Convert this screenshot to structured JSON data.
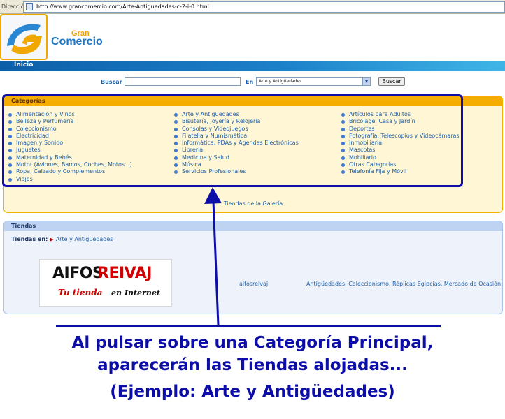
{
  "browser": {
    "address_label": "Dirección",
    "url": "http://www.grancomercio.com/Arte-Antiguedades-c-2-i-0.html"
  },
  "site": {
    "brand_top": "Gran",
    "brand_bottom": "Comercio",
    "accent_color": "#f5ad00",
    "brand_color": "#1f77c7"
  },
  "nav": {
    "items": [
      {
        "label": "Inicio"
      }
    ]
  },
  "search": {
    "label": "Buscar",
    "query": "",
    "in_label": "En",
    "selected_category": "Arte y Antigüedades",
    "button": "Buscar"
  },
  "categories": {
    "title": "Categorías",
    "columns": [
      [
        "Alimentación y Vinos",
        "Belleza y Perfumería",
        "Coleccionismo",
        "Electricidad",
        "Imagen y Sonido",
        "Juguetes",
        "Maternidad y Bebés",
        "Motor (Aviones, Barcos, Coches, Motos...)",
        "Ropa, Calzado y Complementos",
        "Viajes"
      ],
      [
        "Arte y Antigüedades",
        "Bisutería, Joyería y Relojería",
        "Consolas y Videojuegos",
        "Filatelia y Numismática",
        "Informática, PDAs y Agendas Electrónicas",
        "Librería",
        "Medicina y Salud",
        "Música",
        "Servicios Profesionales"
      ],
      [
        "Artículos para Adultos",
        "Bricolage, Casa y Jardín",
        "Deportes",
        "Fotografía, Telescopios y Videocámaras",
        "Inmobiliaria",
        "Mascotas",
        "Mobiliario",
        "Otras Categorías",
        "Telefonía Fija y Móvil"
      ]
    ],
    "gallery_link": "Tiendas de la Galería"
  },
  "stores": {
    "title": "Tiendas",
    "filter_label": "Tiendas en:",
    "filter_value": "Arte y Antigüedades",
    "items": [
      {
        "logo_black": "AIFOS",
        "logo_red": "REIVAJ",
        "slogan_red": "Tu tienda",
        "slogan_black": "en Internet",
        "name": "aifosreivaj",
        "categories": "Antigüedades, Coleccionismo, Réplicas Egipcias, Mercado de Ocasión"
      }
    ]
  },
  "annotation": {
    "line1": "Al pulsar sobre una Categoría Principal,",
    "line2": "aparecerán las Tiendas alojadas...",
    "line3": "(Ejemplo: Arte y Antigüedades)",
    "color": "#0d0da8"
  }
}
